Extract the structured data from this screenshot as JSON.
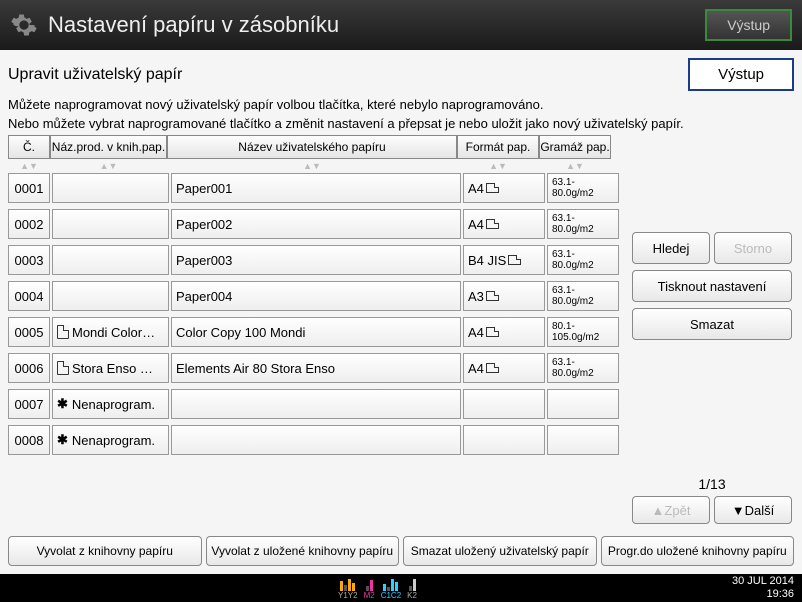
{
  "topbar": {
    "title": "Nastavení papíru v zásobníku",
    "exit": "Výstup"
  },
  "sub": {
    "title": "Upravit uživatelský papír",
    "exit": "Výstup"
  },
  "desc1": "Můžete naprogramovat nový uživatelský papír volbou tlačítka, které nebylo naprogramováno.",
  "desc2": "Nebo můžete vybrat naprogramované tlačítko a změnit nastavení a přepsat je nebo uložit jako nový uživatelský papír.",
  "cols": {
    "c1": "Č.",
    "c2": "Náz.prod. v knih.pap.",
    "c3": "Název uživatelského papíru",
    "c4": "Formát pap.",
    "c5": "Gramáž pap."
  },
  "rows": [
    {
      "num": "0001",
      "lib": "",
      "name": "Paper001",
      "fmt": "A4",
      "wt": "63.1-\n80.0g/m2"
    },
    {
      "num": "0002",
      "lib": "",
      "name": "Paper002",
      "fmt": "A4",
      "wt": "63.1-\n80.0g/m2"
    },
    {
      "num": "0003",
      "lib": "",
      "name": "Paper003",
      "fmt": "B4 JIS",
      "wt": "63.1-\n80.0g/m2"
    },
    {
      "num": "0004",
      "lib": "",
      "name": "Paper004",
      "fmt": "A3",
      "wt": "63.1-\n80.0g/m2"
    },
    {
      "num": "0005",
      "lib": "Mondi Color…",
      "name": "Color Copy 100 Mondi",
      "fmt": "A4",
      "wt": "80.1-\n105.0g/m2",
      "icon": true
    },
    {
      "num": "0006",
      "lib": "Stora Enso …",
      "name": "Elements Air 80 Stora Enso",
      "fmt": "A4",
      "wt": "63.1-\n80.0g/m2",
      "icon": true
    },
    {
      "num": "0007",
      "lib": "✱ Nenaprogram.",
      "name": "",
      "fmt": "",
      "wt": "",
      "star": true
    },
    {
      "num": "0008",
      "lib": "✱ Nenaprogram.",
      "name": "",
      "fmt": "",
      "wt": "",
      "star": true
    }
  ],
  "side": {
    "search": "Hledej",
    "cancel": "Storno",
    "print": "Tisknout nastavení",
    "delete": "Smazat"
  },
  "page": {
    "num": "1/13",
    "prev": "Zpět",
    "next": "Další"
  },
  "bottom": {
    "b1": "Vyvolat z knihovny papíru",
    "b2": "Vyvolat z uložené knihovny papíru",
    "b3": "Smazat uložený uživatelský papír",
    "b4": "Progr.do uložené knihovny papíru"
  },
  "status": {
    "toners": [
      "Y1Y2",
      "M2",
      "C1C2",
      "K2"
    ],
    "date": "30 JUL  2014",
    "time": "19:36"
  }
}
